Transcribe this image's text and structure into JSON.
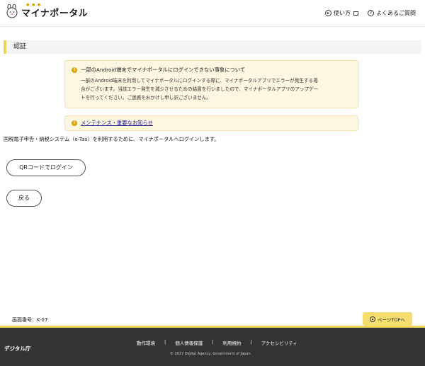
{
  "header": {
    "logo_text": "マイナポータル",
    "usage_label": "使い方",
    "faq_label": "よくあるご質問"
  },
  "page_title": "認証",
  "notices": [
    {
      "title": "一部のAndroid端末でマイナポータルにログインできない事象について",
      "body_lines": [
        "一部のAndroid端末を利用してマイナポータルにログインする際に、マイナポータルアプリでエラーが発生する場",
        "合がございます。当該エラー発生を減少させるための結置を行いましたので、マイナポータルアプリのアップデー",
        "トを行ってください。ご迷惑をおかけし申し訳ございません。"
      ]
    },
    {
      "link": "メンテナンス・重要なお知らせ"
    }
  ],
  "intro_text": "国税電子申告・納税システム（e-Tax）を利用するために、マイナポータルへログインします。",
  "buttons": {
    "qr_login": "QRコードでログイン",
    "back": "戻る"
  },
  "screen_no": "画面番号：K-07",
  "page_top_label": "ページTOPへ",
  "footer": {
    "brand": "デジタル庁",
    "links": [
      "動作環境",
      "個人情報保護",
      "利用規約",
      "アクセシビリティ"
    ],
    "copyright": "© 2017 Digital Agency, Government of Japan."
  },
  "colors": {
    "accent": "#f0d45a",
    "notice_bg": "#fdf6e1",
    "footer_bg": "#333333"
  }
}
